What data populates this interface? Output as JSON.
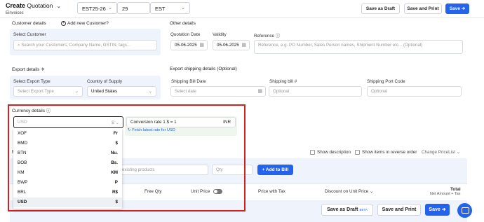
{
  "header": {
    "title": "Create",
    "subtitle": "Quotation",
    "sub_label": "Einvoices",
    "series": "EST25-26",
    "number": "29",
    "prefix": "EST",
    "save_draft": "Save as Draft",
    "save_print": "Save and Print",
    "save": "Save"
  },
  "customer": {
    "section": "Customer details",
    "add_new": "Add new Customer?",
    "label": "Select Customer",
    "placeholder": "Search your Customers, Company Name, GSTIN, tags..."
  },
  "other": {
    "section": "Other details",
    "quotation_date_label": "Quotation Date",
    "quotation_date": "05-06-2025",
    "validity_label": "Validity",
    "validity_date": "05-06-2025",
    "reference_label": "Reference",
    "reference_placeholder": "Reference, e.g. PO Number, Sales Person names, Shipment Number etc... (Optional)"
  },
  "export": {
    "section": "Export details",
    "type_label": "Select Export Type",
    "type_placeholder": "Select Export Type",
    "country_label": "Country of Supply",
    "country_value": "United States"
  },
  "shipping": {
    "section": "Export shipping details (Optional)",
    "bill_date_label": "Shipping Bill Date",
    "bill_date_placeholder": "Select date",
    "bill_no_label": "Shipping bill #",
    "bill_no_placeholder": "Optional",
    "port_label": "Shipping Port Code",
    "port_placeholder": "Optional"
  },
  "currency": {
    "section": "Currency details",
    "search_value": "USD",
    "search_symbol": "$",
    "options": [
      {
        "code": "XOF",
        "symbol": "Fr"
      },
      {
        "code": "BMD",
        "symbol": "$"
      },
      {
        "code": "BTN",
        "symbol": "Nu."
      },
      {
        "code": "BOB",
        "symbol": "Bs."
      },
      {
        "code": "KM",
        "symbol": "KM"
      },
      {
        "code": "BWP",
        "symbol": "P"
      },
      {
        "code": "BRL",
        "symbol": "R$"
      },
      {
        "code": "USD",
        "symbol": "$"
      }
    ],
    "conversion_label": "Conversion rate 1 $ =",
    "conversion_value": "1",
    "conversion_unit": "INR",
    "fetch_label": "Fetch latest rate for USD"
  },
  "items": {
    "show_description": "Show description",
    "show_reverse": "Show items in reverse order",
    "change_pricelist": "Change PriceList",
    "product_placeholder": "existing products",
    "qty_placeholder": "Qty",
    "add_to_bill": "+ Add to Bill",
    "col_free_qty": "Free Qty",
    "col_unit_price": "Unit Price",
    "col_price_tax": "Price with Tax",
    "col_discount": "Discount on",
    "col_discount_sel": "Unit Price",
    "col_total": "Total",
    "col_total_sub": "Net Amount + Tax"
  },
  "footer": {
    "save_draft": "Save as Draft",
    "beta": "BETA",
    "save_print": "Save and Print",
    "save": "Save"
  }
}
